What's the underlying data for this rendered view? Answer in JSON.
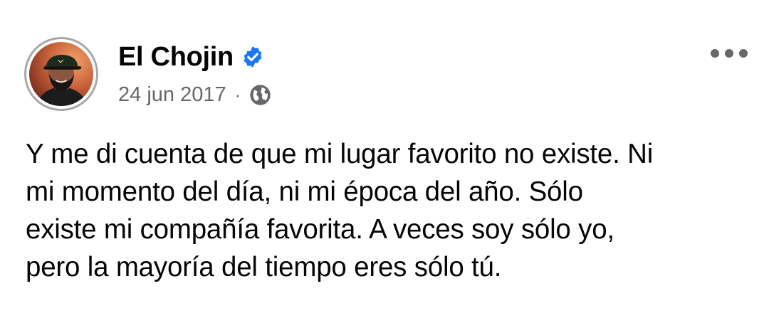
{
  "post": {
    "author": {
      "name": "El Chojin",
      "verified": true,
      "avatar": "profile-photo"
    },
    "timestamp": "24 jun 2017",
    "separator": "·",
    "audience_icon": "globe-icon",
    "more_icon": "more-options-icon",
    "text_lines": [
      "Y me di cuenta de que mi lugar favorito no existe. Ni",
      "mi momento del día, ni mi época del año. Sólo",
      "existe mi compañía favorita. A veces soy sólo yo,",
      "pero la mayoría del tiempo eres sólo tú."
    ]
  },
  "colors": {
    "verified_badge": "#1877f2",
    "secondary_text": "#65676b",
    "primary_text": "#050505"
  }
}
